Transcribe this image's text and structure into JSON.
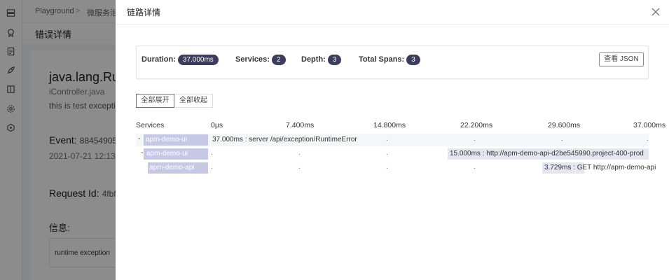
{
  "background": {
    "breadcrumb": [
      "Playground",
      "微服务治"
    ],
    "page_title": "错误详情",
    "exception_class": "java.lang.Ru",
    "file": "iController.java",
    "message": "this is test exceptio",
    "event_label": "Event:",
    "event_value": "88454905",
    "timestamp": "2021-07-21 12:13",
    "request_label": "Request Id:",
    "request_value": "4fbf",
    "info_label": "信息:",
    "info_text": "runtime exception"
  },
  "drawer": {
    "title": "链路详情",
    "summary": {
      "duration_label": "Duration:",
      "duration_value": "37.000ms",
      "services_label": "Services:",
      "services_value": "2",
      "depth_label": "Depth:",
      "depth_value": "3",
      "spans_label": "Total Spans:",
      "spans_value": "3",
      "json_button": "查看 JSON"
    },
    "expand_all": "全部展开",
    "collapse_all": "全部收起",
    "columns": [
      "Services",
      "0μs",
      "7.400ms",
      "14.800ms",
      "22.200ms",
      "29.600ms",
      "37.000ms"
    ],
    "spans": [
      {
        "toggle": "-",
        "service": "apm-demo-ui",
        "label": "37.000ms : server /api/exception/RuntimeError",
        "start_ms": 0,
        "duration_ms": 37.0
      },
      {
        "toggle": "-",
        "service": "apm-demo-ui",
        "label": "15.000ms : http://apm-demo-api-d2be545990.project-400-prod",
        "start_ms": 22.2,
        "duration_ms": 15.0
      },
      {
        "toggle": "",
        "service": "apm-demo-api",
        "label": "3.729ms : GET http://apm-demo-api",
        "start_ms": 29.6,
        "duration_ms": 3.729
      }
    ]
  },
  "colors": {
    "accent": "#3c3d58",
    "service_tag": "#c6c8e6",
    "mask": "#737373"
  }
}
